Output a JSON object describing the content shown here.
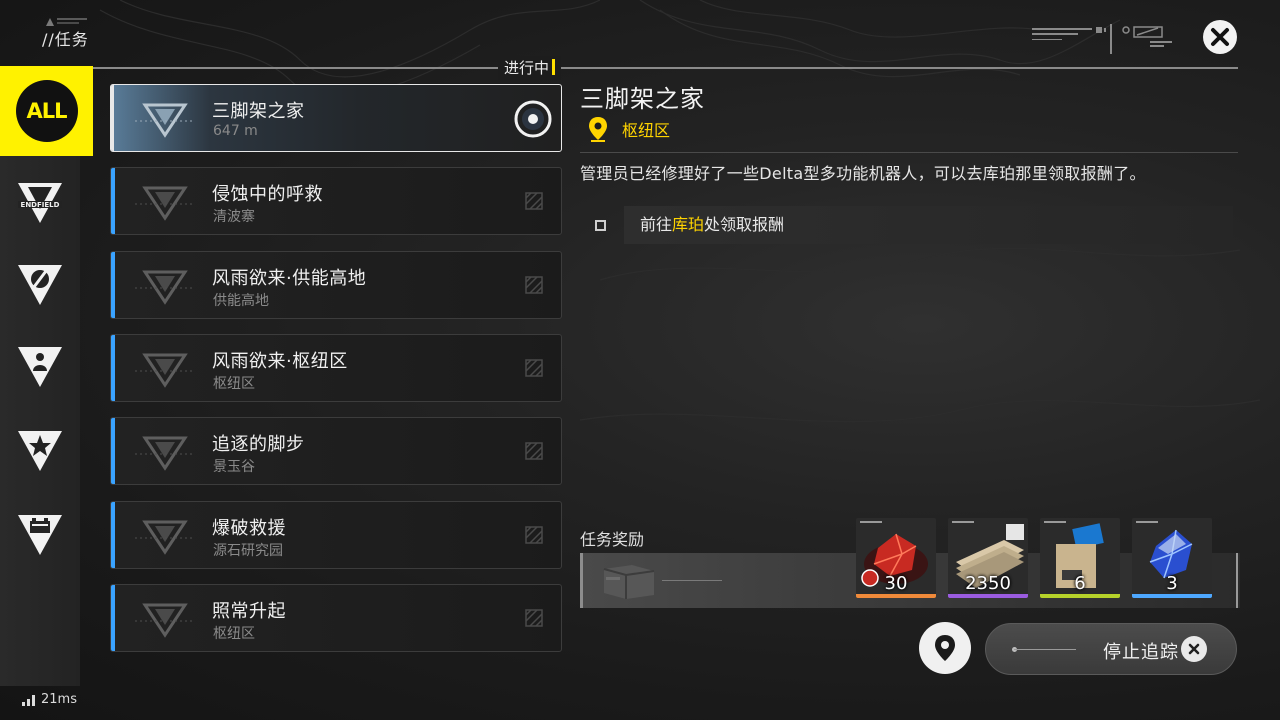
{
  "header": {
    "breadcrumb": "//任务",
    "status_tag": "进行中",
    "close_icon": "close-icon"
  },
  "rail": {
    "items": [
      {
        "id": "all",
        "label": "ALL",
        "icon": "all-badge",
        "active": true
      },
      {
        "id": "endfield",
        "label": "ENDFIELD",
        "icon": "endfield-icon",
        "active": false
      },
      {
        "id": "side",
        "label": "",
        "icon": "compass-icon",
        "active": false
      },
      {
        "id": "npc",
        "label": "",
        "icon": "person-icon",
        "active": false
      },
      {
        "id": "star",
        "label": "",
        "icon": "star-icon",
        "active": false
      },
      {
        "id": "event",
        "label": "",
        "icon": "battery-icon",
        "active": false
      }
    ]
  },
  "quests": [
    {
      "title": "三脚架之家",
      "sub": "647 m",
      "active": true
    },
    {
      "title": "侵蚀中的呼救",
      "sub": "清波寨",
      "active": false
    },
    {
      "title": "风雨欲来·供能高地",
      "sub": "供能高地",
      "active": false
    },
    {
      "title": "风雨欲来·枢纽区",
      "sub": "枢纽区",
      "active": false
    },
    {
      "title": "追逐的脚步",
      "sub": "景玉谷",
      "active": false
    },
    {
      "title": "爆破救援",
      "sub": "源石研究园",
      "active": false
    },
    {
      "title": "照常升起",
      "sub": "枢纽区",
      "active": false
    }
  ],
  "detail": {
    "title": "三脚架之家",
    "location": "枢纽区",
    "description": "管理员已经修理好了一些Delta型多功能机器人，可以去库珀那里领取报酬了。",
    "objective_pre": "前往",
    "objective_highlight": "库珀",
    "objective_post": "处领取报酬"
  },
  "rewards": {
    "label": "任务奖励",
    "items": [
      {
        "name": "red-crystal",
        "qty": "30",
        "rarity_color": "#f08a3a"
      },
      {
        "name": "money-bundle",
        "qty": "2350",
        "rarity_color": "#9b5ce0"
      },
      {
        "name": "exp-record",
        "qty": "6",
        "rarity_color": "#b6d22a"
      },
      {
        "name": "blue-crystal",
        "qty": "3",
        "rarity_color": "#4ea8ff"
      }
    ]
  },
  "actions": {
    "stop_tracking": "停止追踪",
    "map_icon": "map-pin-icon"
  },
  "status": {
    "ping": "21ms"
  },
  "colors": {
    "accent_yellow": "#fff200",
    "accent_blue": "#3aa3ff",
    "highlight_gold": "#ffd400"
  }
}
